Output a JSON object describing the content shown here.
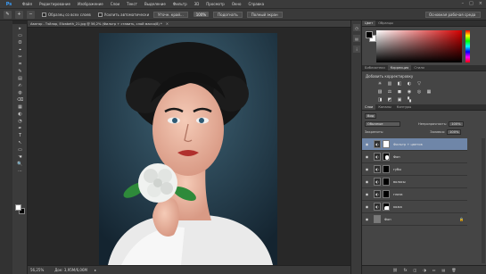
{
  "app": {
    "logo": "Ps",
    "menu": [
      "Файл",
      "Редактирование",
      "Изображение",
      "Слои",
      "Текст",
      "Выделение",
      "Фильтр",
      "3D",
      "Просмотр",
      "Окно",
      "Справка"
    ],
    "window_controls": [
      "–",
      "□",
      "×"
    ]
  },
  "options": {
    "tool_icon": "quick-selection-icon",
    "sample_all_label": "Образец со всех слоев",
    "auto_enhance_label": "Усилить автоматически",
    "refine_edge_label": "Уточн. край...",
    "zoom_value": "100%",
    "fit_screen": "Подогнать",
    "fill_screen": "Полный экран",
    "workspace": "Основная рабочая среда"
  },
  "document": {
    "tab_label": "Аватар - Тэйлор, Elizabeth_21.jpg @ 56,2% (Фильтр + ставить, слой маска/8) *",
    "close": "×"
  },
  "status": {
    "zoom": "56,25%",
    "doc_info": "Док: 3,95M/6,06M",
    "arrow": "▸"
  },
  "tools": [
    "▸",
    "▭",
    "ʘ",
    "⌖",
    "✂",
    "⌗",
    "✎",
    "▤",
    "✍",
    "◍",
    "⌫",
    "▦",
    "◐",
    "◔",
    "✒",
    "T",
    "↖",
    "▭",
    "☚",
    "🔍",
    "⋯"
  ],
  "colors": {
    "foreground": "#ffffff",
    "background": "#000000",
    "selected_layer": "#6f86a8",
    "accent": "#d40000"
  },
  "panels": {
    "color_tabs": [
      "Цвет",
      "Образцы"
    ],
    "adjust_tabs": [
      "Библиотеки",
      "Коррекция",
      "Стили"
    ],
    "adjust_title": "Добавить корректировку",
    "adjust_icons_row1": [
      "☀",
      "▥",
      "◧",
      "◐",
      "▽",
      ""
    ],
    "adjust_icons_row2": [
      "▨",
      "⚖",
      "◼",
      "◉",
      "◎",
      "▦"
    ],
    "adjust_icons_row3": [
      "◨",
      "◩",
      "▣",
      "▚"
    ],
    "layers_tabs": [
      "Слои",
      "Каналы",
      "Контуры"
    ],
    "kind_label": "Вид",
    "blend_mode": "Обычные",
    "opacity_label": "Непрозрачность:",
    "opacity_value": "100%",
    "lock_label": "Закрепить:",
    "fill_label": "Заливка:",
    "fill_value": "100%",
    "layers": [
      {
        "name": "Фильтр + цветов",
        "selected": true,
        "thumb": "mask"
      },
      {
        "name": "Фон",
        "selected": false,
        "thumb": "mask"
      },
      {
        "name": "губы",
        "selected": false,
        "thumb": "mask"
      },
      {
        "name": "волосы",
        "selected": false,
        "thumb": "mask"
      },
      {
        "name": "глаза",
        "selected": false,
        "thumb": "mask"
      },
      {
        "name": "кожа",
        "selected": false,
        "thumb": "mask"
      },
      {
        "name": "Фон",
        "selected": false,
        "thumb": "photo"
      }
    ],
    "footer_icons": [
      "⛓",
      "fx",
      "◫",
      "◑",
      "▭",
      "▤",
      "🗑"
    ]
  }
}
